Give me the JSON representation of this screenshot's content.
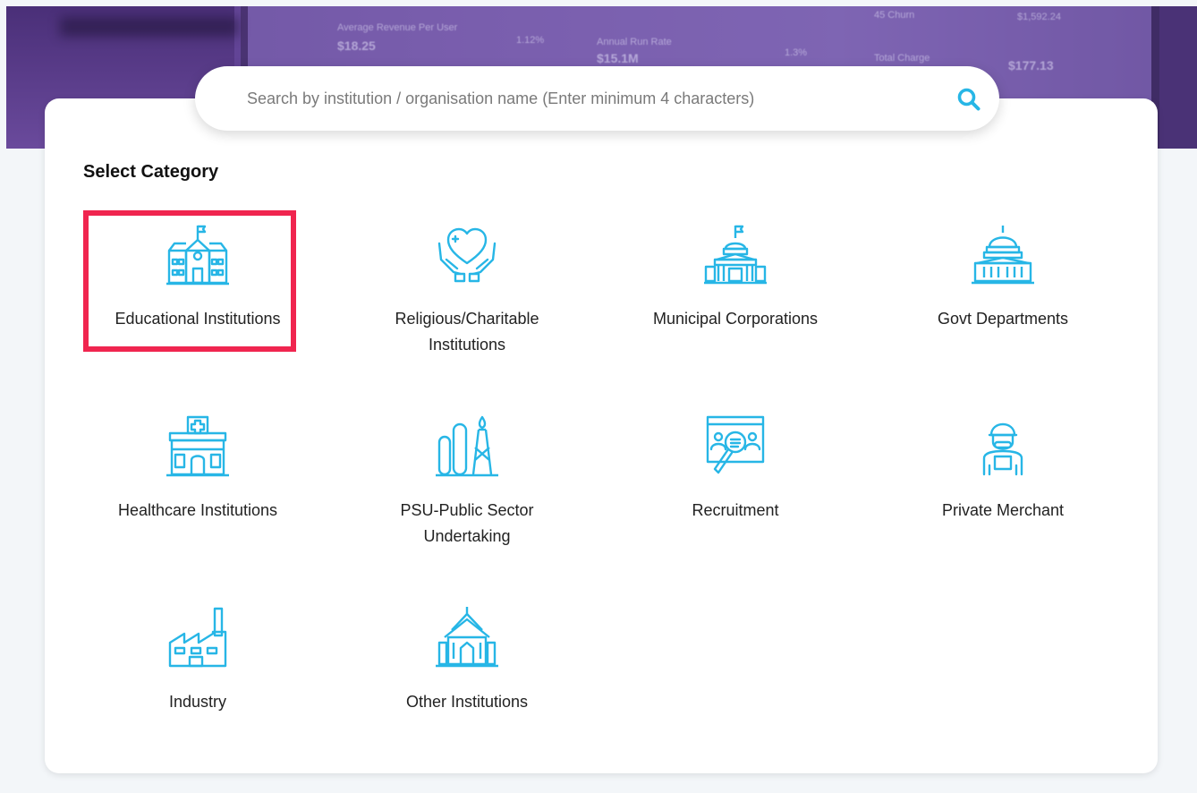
{
  "banner": {
    "ghost_texts": [
      "Average Revenue Per User",
      "$18.25",
      "1.12%",
      "Annual Run Rate",
      "$15.1M",
      "1.3%",
      "45 Churn",
      "$1,592.24",
      "Total Charge",
      "$177.13"
    ]
  },
  "search": {
    "placeholder": "Search by institution / organisation name (Enter minimum 4 characters)",
    "value": "",
    "icon": "search-icon"
  },
  "section_title": "Select Category",
  "categories": [
    {
      "label": "Educational Institutions",
      "icon": "school-building-icon",
      "selected": true
    },
    {
      "label": "Religious/Charitable Institutions",
      "icon": "heart-in-hands-icon",
      "selected": false
    },
    {
      "label": "Municipal Corporations",
      "icon": "capitol-building-flag-icon",
      "selected": false
    },
    {
      "label": "Govt Departments",
      "icon": "capitol-dome-icon",
      "selected": false
    },
    {
      "label": "Healthcare Institutions",
      "icon": "hospital-icon",
      "selected": false
    },
    {
      "label": "PSU-Public Sector Undertaking",
      "icon": "refinery-icon",
      "selected": false
    },
    {
      "label": "Recruitment",
      "icon": "candidate-search-icon",
      "selected": false
    },
    {
      "label": "Private Merchant",
      "icon": "merchant-person-icon",
      "selected": false
    },
    {
      "label": "Industry",
      "icon": "factory-icon",
      "selected": false
    },
    {
      "label": "Other Institutions",
      "icon": "temple-icon",
      "selected": false
    }
  ],
  "colors": {
    "icon": "#27b6e6",
    "selection": "#f0254f",
    "banner": "#6b4c9f"
  }
}
